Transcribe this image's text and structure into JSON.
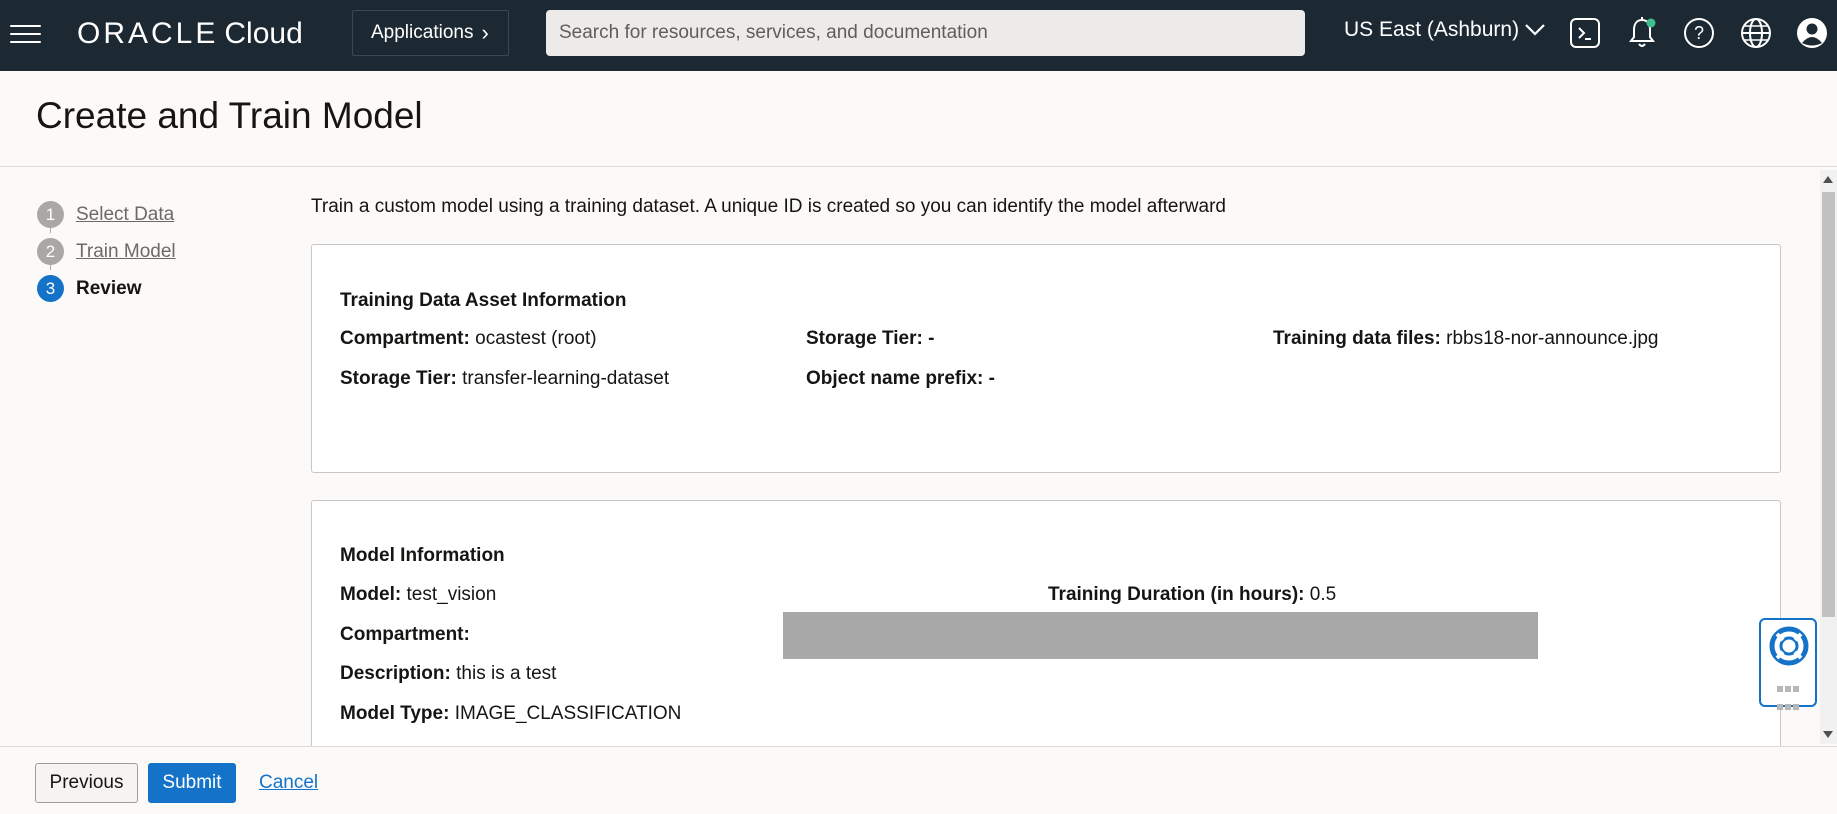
{
  "topbar": {
    "brand": "ORACLE",
    "product": "Cloud",
    "applications_label": "Applications",
    "search_placeholder": "Search for resources, services, and documentation",
    "region_label": "US East (Ashburn)",
    "icons": [
      "hamburger-menu-icon",
      "cloud-shell-icon",
      "bell-icon",
      "help-icon",
      "globe-icon",
      "user-icon"
    ],
    "notification_dot_color": "#3fbf91"
  },
  "page": {
    "title": "Create and Train Model"
  },
  "steps": [
    {
      "number": "1",
      "label": "Select Data",
      "state": "completed"
    },
    {
      "number": "2",
      "label": "Train Model",
      "state": "completed"
    },
    {
      "number": "3",
      "label": "Review",
      "state": "active"
    }
  ],
  "intro": "Train a custom model using a training dataset. A unique ID is created so you can identify the model afterward",
  "training_data": {
    "title": "Training Data Asset Information",
    "compartment_label": "Compartment:",
    "compartment_value": "ocastest (root)",
    "storage_tier_label_1": "Storage Tier:",
    "storage_tier_value_1": "-",
    "files_label": "Training data files:",
    "files_value": "rbbs18-nor-announce.jpg",
    "storage_tier_label_2": "Storage Tier:",
    "storage_tier_value_2": "transfer-learning-dataset",
    "prefix_label": "Object name prefix:",
    "prefix_value": "-"
  },
  "model_info": {
    "title": "Model Information",
    "model_label": "Model:",
    "model_value": "test_vision",
    "duration_label": "Training Duration (in hours):",
    "duration_value": "0.5",
    "compartment_label": "Compartment:",
    "description_label": "Description:",
    "description_value": "this is a test",
    "type_label": "Model Type:",
    "type_value": "IMAGE_CLASSIFICATION"
  },
  "footer": {
    "previous_label": "Previous",
    "submit_label": "Submit",
    "cancel_label": "Cancel"
  },
  "colors": {
    "navbar": "#1d2932",
    "accent": "#1473c9",
    "step_inactive": "#a9a8a6",
    "redaction": "#a8a8a8"
  }
}
